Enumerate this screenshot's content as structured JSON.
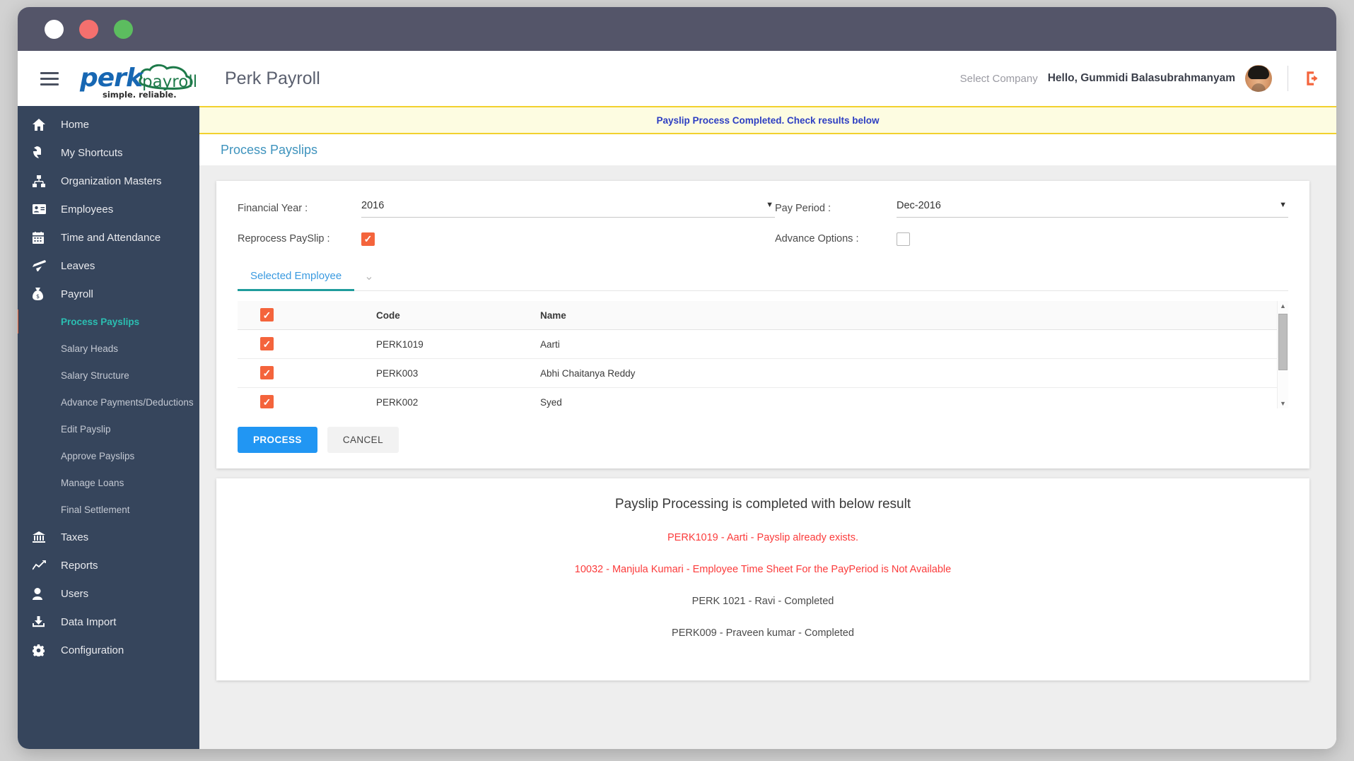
{
  "window": {
    "dots": [
      "white",
      "red",
      "green"
    ]
  },
  "header": {
    "logo": {
      "perk": "perk",
      "payroll": "payroll",
      "tagline": "simple. reliable."
    },
    "app_title": "Perk Payroll",
    "select_company": "Select Company",
    "greeting": "Hello, Gummidi Balasubrahmanyam"
  },
  "sidebar": {
    "items": [
      {
        "label": "Home",
        "icon": "home-icon"
      },
      {
        "label": "My Shortcuts",
        "icon": "shortcut-arrow-icon"
      },
      {
        "label": "Organization Masters",
        "icon": "org-chart-icon"
      },
      {
        "label": "Employees",
        "icon": "id-card-icon"
      },
      {
        "label": "Time and Attendance",
        "icon": "calendar-icon"
      },
      {
        "label": "Leaves",
        "icon": "airplane-icon"
      },
      {
        "label": "Payroll",
        "icon": "money-bag-icon"
      }
    ],
    "payroll_subitems": [
      {
        "label": "Process Payslips",
        "active": true
      },
      {
        "label": "Salary Heads",
        "active": false
      },
      {
        "label": "Salary Structure",
        "active": false
      },
      {
        "label": "Advance Payments/Deductions",
        "active": false
      },
      {
        "label": "Edit Payslip",
        "active": false
      },
      {
        "label": "Approve Payslips",
        "active": false
      },
      {
        "label": "Manage Loans",
        "active": false
      },
      {
        "label": "Final Settlement",
        "active": false
      }
    ],
    "items_tail": [
      {
        "label": "Taxes",
        "icon": "bank-icon"
      },
      {
        "label": "Reports",
        "icon": "line-chart-icon"
      },
      {
        "label": "Users",
        "icon": "user-icon"
      },
      {
        "label": "Data Import",
        "icon": "download-icon"
      },
      {
        "label": "Configuration",
        "icon": "gear-icon"
      }
    ]
  },
  "alert": {
    "message": "Payslip Process Completed. Check results below"
  },
  "page": {
    "title": "Process Payslips"
  },
  "form": {
    "financial_year_label": "Financial Year :",
    "financial_year_value": "2016",
    "pay_period_label": "Pay Period :",
    "pay_period_value": "Dec-2016",
    "reprocess_label": "Reprocess PaySlip :",
    "reprocess_checked": "checked",
    "advance_options_label": "Advance Options :",
    "advance_options_checked": "unchecked",
    "caret": "▼"
  },
  "tabs": {
    "selected_employee": "Selected Employee",
    "chevron": "⌄"
  },
  "table": {
    "columns": {
      "code": "Code",
      "name": "Name"
    },
    "rows": [
      {
        "checked": true,
        "code": "PERK1019",
        "name": "Aarti"
      },
      {
        "checked": true,
        "code": "PERK003",
        "name": "Abhi Chaitanya Reddy"
      },
      {
        "checked": true,
        "code": "PERK002",
        "name": "Syed"
      }
    ],
    "scroll_up": "▲",
    "scroll_down": "▼"
  },
  "buttons": {
    "process": "PROCESS",
    "cancel": "CANCEL"
  },
  "results": {
    "title": "Payslip Processing is completed with below result",
    "lines": [
      {
        "text": "PERK1019 - Aarti  - Payslip already exists.",
        "status": "error"
      },
      {
        "text": "10032 - Manjula Kumari  - Employee Time Sheet For the PayPeriod is Not Available",
        "status": "error"
      },
      {
        "text": "PERK 1021 - Ravi -  Completed",
        "status": "ok"
      },
      {
        "text": "PERK009 - Praveen kumar -  Completed",
        "status": "ok"
      }
    ]
  },
  "colors": {
    "sidebar_bg": "#36455c",
    "titlebar_bg": "#545569",
    "accent_orange": "#f4643c",
    "accent_blue": "#2196f3",
    "active_teal": "#2bbfb2",
    "alert_bg": "#fdfce1",
    "alert_border": "#f2d12e",
    "alert_text": "#2d3ec2",
    "error_red": "#fb3b3b"
  }
}
